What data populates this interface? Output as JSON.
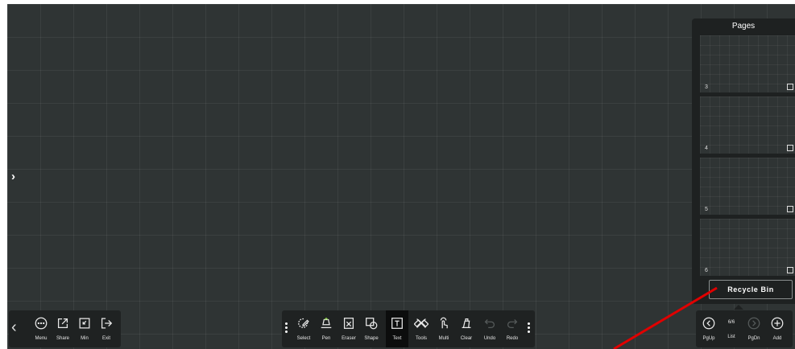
{
  "left_toolbar": {
    "collapse_arrow": "‹",
    "items": [
      {
        "label": "Menu",
        "icon": "menu-icon"
      },
      {
        "label": "Share",
        "icon": "share-icon"
      },
      {
        "label": "Min",
        "icon": "minimize-icon"
      },
      {
        "label": "Exit",
        "icon": "exit-icon"
      }
    ]
  },
  "main_toolbar": {
    "items": [
      {
        "label": "Select",
        "icon": "select-icon"
      },
      {
        "label": "Pen",
        "icon": "pen-icon"
      },
      {
        "label": "Eraser",
        "icon": "eraser-icon"
      },
      {
        "label": "Shape",
        "icon": "shape-icon"
      },
      {
        "label": "Text",
        "icon": "text-icon",
        "active": true
      },
      {
        "label": "Tools",
        "icon": "tools-icon"
      },
      {
        "label": "Multi",
        "icon": "multi-touch-icon"
      },
      {
        "label": "Clear",
        "icon": "clear-icon"
      },
      {
        "label": "Undo",
        "icon": "undo-icon",
        "disabled": true
      },
      {
        "label": "Redo",
        "icon": "redo-icon",
        "disabled": true
      }
    ]
  },
  "pages_panel": {
    "title": "Pages",
    "thumbnails": [
      {
        "number": "3"
      },
      {
        "number": "4"
      },
      {
        "number": "5"
      },
      {
        "number": "6"
      }
    ],
    "recycle_bin_label": "Recycle Bin"
  },
  "page_nav": {
    "page_counter": "6/6",
    "items": [
      {
        "label": "PgUp",
        "icon": "chevron-left-circle-icon"
      },
      {
        "label": "List",
        "icon": "page-list-icon"
      },
      {
        "label": "PgDn",
        "icon": "chevron-right-circle-icon",
        "disabled": true
      },
      {
        "label": "Add",
        "icon": "plus-circle-icon"
      }
    ]
  },
  "colors": {
    "board": "#2f3434",
    "toolbar": "#1f2222",
    "annotation_arrow": "#e00000"
  }
}
